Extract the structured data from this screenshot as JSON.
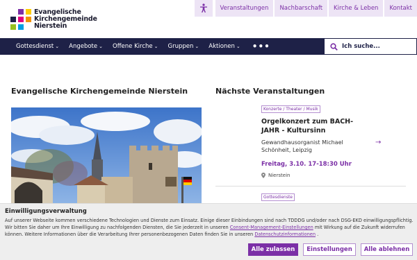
{
  "logo": {
    "line1": "Evangelische",
    "line2": "Kirchengemeinde",
    "line3": "Nierstein"
  },
  "topnav": {
    "items": [
      "Veranstaltungen",
      "Nachbarschaft",
      "Kirche & Leben",
      "Kontakt"
    ]
  },
  "mainnav": {
    "items": [
      "Gottesdienst",
      "Angebote",
      "Offene Kirche",
      "Gruppen",
      "Aktionen"
    ],
    "more": "•••"
  },
  "search": {
    "placeholder": "Ich suche..."
  },
  "left": {
    "heading": "Evangelische Kirchengemeinde Nierstein"
  },
  "right": {
    "heading": "Nächste Veranstaltungen",
    "event1": {
      "tag": "Konzerte / Theater / Musik",
      "title": "Orgelkonzert zum BACH-JAHR - Kultursinn",
      "subtitle": "Gewandhausorganist Michael Schönheit, Leipzig",
      "date": "Freitag, 3.10. 17-18:30 Uhr",
      "location": "Nierstein"
    },
    "event2": {
      "tag": "Gottesdienste"
    }
  },
  "consent": {
    "title": "Einwilligungsverwaltung",
    "text1": "Auf unserer Webseite kommen verschiedene Technologien und Dienste zum Einsatz. Einige dieser Einbindungen sind nach TDDDG und/oder nach DSG-EKD einwilligungspflichtig. Wir bitten Sie daher um Ihre Einwilligung zu nachfolgenden Diensten, die Sie jederzeit in unseren",
    "link1": "Consent-Management-Einstellungen",
    "text2": "mit Wirkung auf die Zukunft widerrufen können. Weitere Informationen über die Verarbeitung Ihrer personenbezogenen Daten finden Sie in unseren",
    "link2": "Datenschutzinformationen",
    "text3": ".",
    "accept_all": "Alle zulassen",
    "settings": "Einstellungen",
    "reject_all": "Alle ablehnen"
  },
  "colors": {
    "accent": "#7b2fa6",
    "nav_bg": "#1e2147",
    "tag_border": "#b48fd0"
  }
}
